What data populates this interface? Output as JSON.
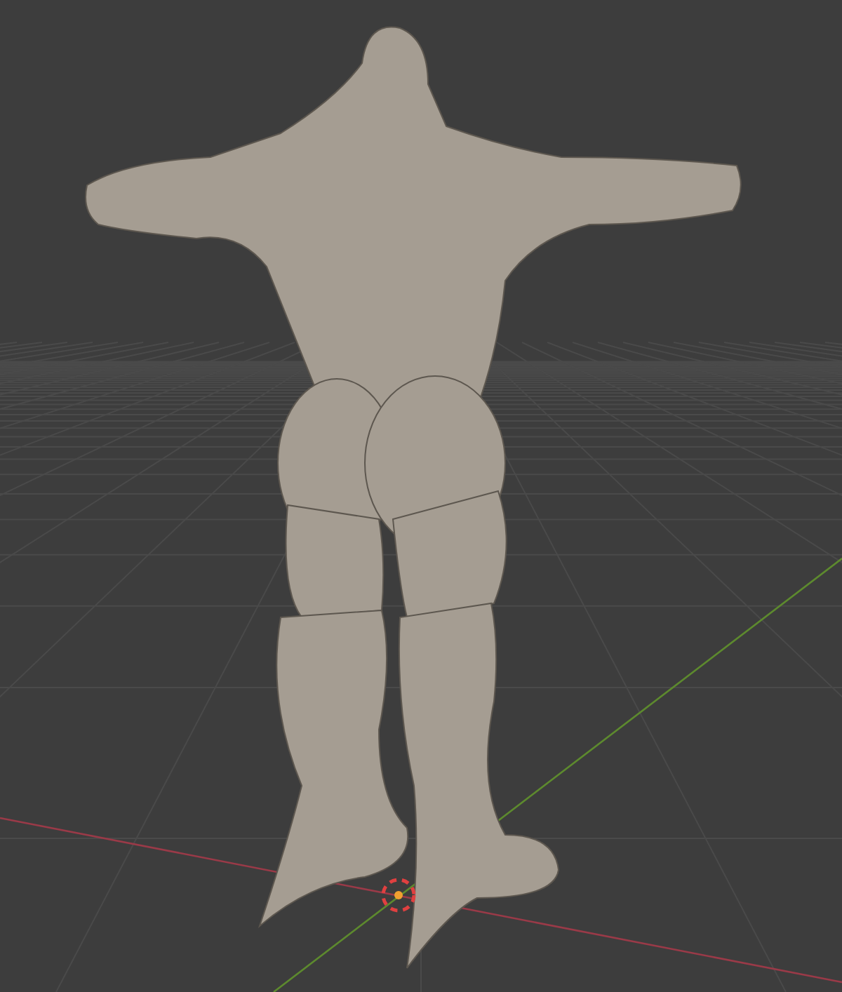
{
  "viewport": {
    "show_floor": true,
    "show_axes": true,
    "show_cursor": true
  }
}
